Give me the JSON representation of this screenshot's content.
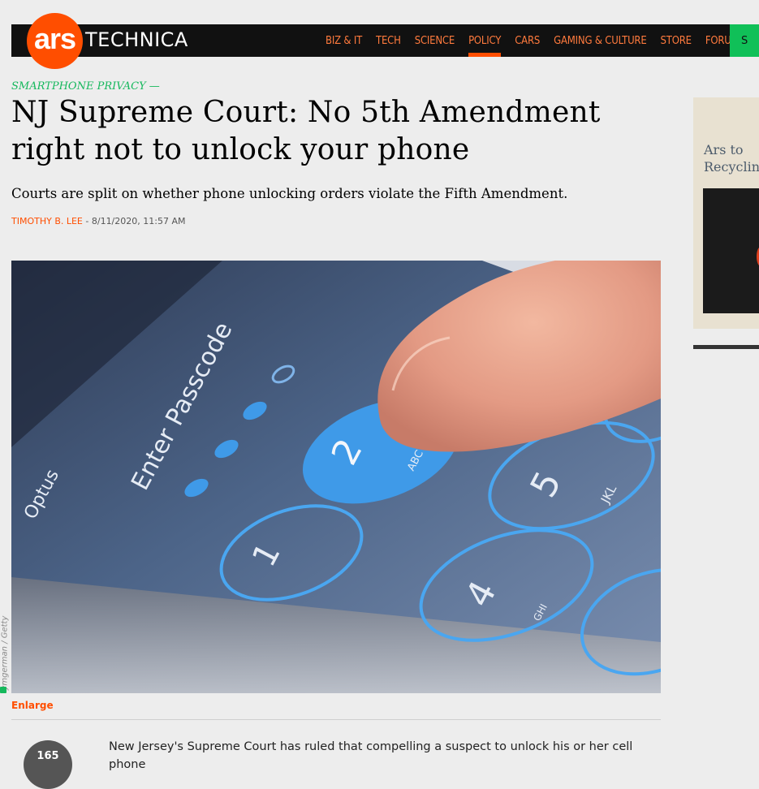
{
  "site": {
    "logo_primary": "ars",
    "logo_secondary": "TECHNICA"
  },
  "nav": {
    "items": [
      {
        "label": "BIZ & IT",
        "active": false
      },
      {
        "label": "TECH",
        "active": false
      },
      {
        "label": "SCIENCE",
        "active": false
      },
      {
        "label": "POLICY",
        "active": true
      },
      {
        "label": "CARS",
        "active": false
      },
      {
        "label": "GAMING & CULTURE",
        "active": false
      },
      {
        "label": "STORE",
        "active": false
      },
      {
        "label": "FORUMS",
        "active": false
      }
    ],
    "subscribe_label": "S"
  },
  "article": {
    "kicker": "SMARTPHONE PRIVACY —",
    "title": "NJ Supreme Court: No 5th Amendment right not to unlock your phone",
    "dek": "Courts are split on whether phone unlocking orders violate the Fifth Amendment.",
    "author": "TIMOTHY B. LEE",
    "separator": " - ",
    "date": "8/11/2020, 11:57 AM",
    "image_credit": "ymgerman / Getty",
    "enlarge_label": "Enlarge",
    "comment_count": "165",
    "body_first_line": "New Jersey's Supreme Court has ruled that compelling a suspect to unlock his or her cell phone"
  },
  "hero_image": {
    "lock_text": "Enter Passcode",
    "carrier": "Optus",
    "keys": [
      {
        "digit": "1",
        "letters": ""
      },
      {
        "digit": "2",
        "letters": "ABC"
      },
      {
        "digit": "4",
        "letters": "GHI"
      },
      {
        "digit": "5",
        "letters": "JKL"
      }
    ]
  },
  "sidebar_ad": {
    "text_line1": "Ars to",
    "text_line2": "Recyclin"
  },
  "colors": {
    "brand": "#ff4e00",
    "kicker": "#15b85c",
    "nav_bg": "#111111"
  }
}
